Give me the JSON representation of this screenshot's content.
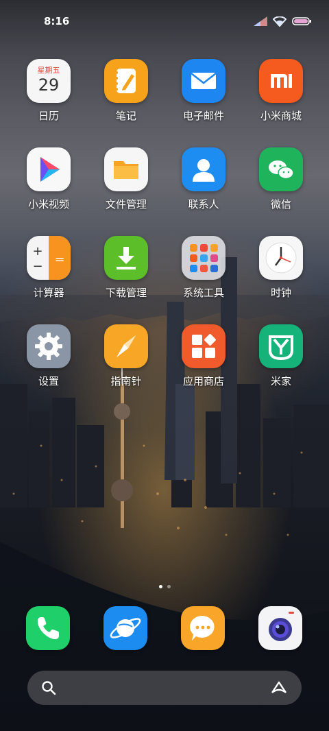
{
  "status_bar": {
    "time": "8:16",
    "icons": [
      "signal-icon",
      "wifi-icon",
      "battery-icon"
    ]
  },
  "apps": [
    {
      "name": "calendar",
      "label": "日历",
      "icon": "calendar-icon",
      "calendar_day": "星期五",
      "calendar_date": "29"
    },
    {
      "name": "notes",
      "label": "笔记",
      "icon": "notes-icon"
    },
    {
      "name": "email",
      "label": "电子邮件",
      "icon": "email-icon"
    },
    {
      "name": "mi-store",
      "label": "小米商城",
      "icon": "mi-store-icon"
    },
    {
      "name": "mi-video",
      "label": "小米视频",
      "icon": "video-play-icon"
    },
    {
      "name": "file-manager",
      "label": "文件管理",
      "icon": "folder-icon"
    },
    {
      "name": "contacts",
      "label": "联系人",
      "icon": "contacts-icon"
    },
    {
      "name": "wechat",
      "label": "微信",
      "icon": "wechat-icon"
    },
    {
      "name": "calculator",
      "label": "计算器",
      "icon": "calculator-icon"
    },
    {
      "name": "downloads",
      "label": "下载管理",
      "icon": "download-icon"
    },
    {
      "name": "system-tools",
      "label": "系统工具",
      "icon": "folder-grid-icon"
    },
    {
      "name": "clock",
      "label": "时钟",
      "icon": "clock-icon"
    },
    {
      "name": "settings",
      "label": "设置",
      "icon": "gear-icon"
    },
    {
      "name": "compass",
      "label": "指南针",
      "icon": "compass-icon"
    },
    {
      "name": "app-store",
      "label": "应用商店",
      "icon": "app-store-icon"
    },
    {
      "name": "mi-home",
      "label": "米家",
      "icon": "mi-home-icon"
    }
  ],
  "page_indicator": {
    "pages": 2,
    "active": 1
  },
  "dock": [
    {
      "name": "phone",
      "icon": "phone-icon"
    },
    {
      "name": "browser",
      "icon": "browser-planet-icon"
    },
    {
      "name": "messages",
      "icon": "message-icon"
    },
    {
      "name": "camera",
      "icon": "camera-icon"
    }
  ],
  "search_bar": {
    "left_icon": "search-icon",
    "right_icon": "assistant-icon"
  },
  "colors": {
    "notes": "#f6a21b",
    "email": "#1e86f0",
    "mi_store": "#f55a1f",
    "contacts": "#1e8df2",
    "wechat": "#1fb45c",
    "downloads": "#5cbf2a",
    "compass": "#f7a626",
    "app_store": "#f15a2b",
    "mi_home": "#15b37a",
    "phone": "#1fcf6a",
    "browser": "#1d8cf1",
    "messages": "#f8a52a",
    "settings": "#8a96a6"
  }
}
